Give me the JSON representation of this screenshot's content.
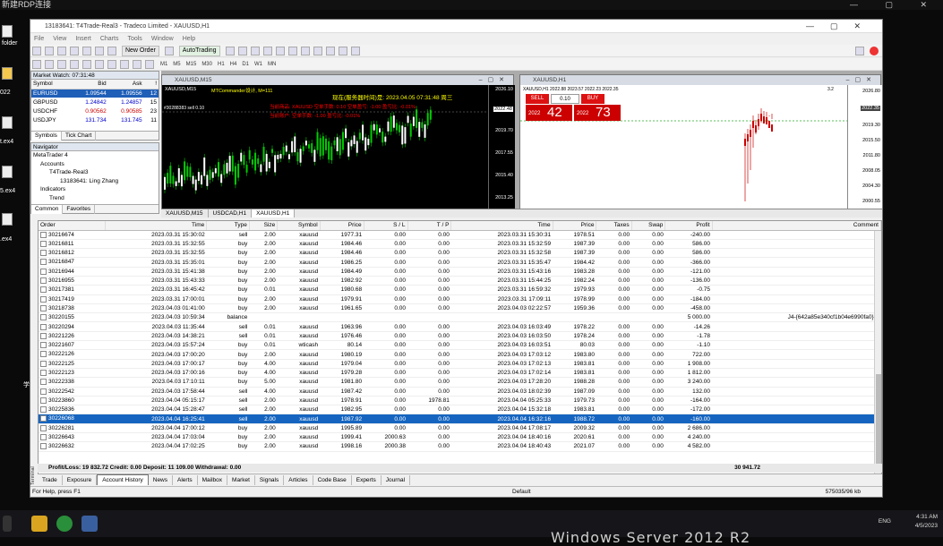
{
  "rdp": {
    "title": "新建RDP连接",
    "controls": "— ▢ ✕"
  },
  "desktop": {
    "folder_label": "folder",
    "item2": "022",
    "item3": "t.ex4",
    "item4": "5.ex4",
    "item5": ".ex4",
    "item6": "学"
  },
  "window": {
    "title": "13183641: T4Trade-Real3 - Tradeco Limited - XAUUSD,H1",
    "menu": [
      "File",
      "View",
      "Insert",
      "Charts",
      "Tools",
      "Window",
      "Help"
    ],
    "toolbar": {
      "new_order": "New Order",
      "autotrading": "AutoTrading"
    },
    "timeframes": [
      "M1",
      "M5",
      "M15",
      "M30",
      "H1",
      "H4",
      "D1",
      "W1",
      "MN"
    ]
  },
  "market_watch": {
    "header": "Market Watch: 07:31:48",
    "columns": [
      "Symbol",
      "Bid",
      "Ask",
      "!"
    ],
    "rows": [
      {
        "symbol": "EURUSD",
        "bid": "1.09544",
        "ask": "1.09556",
        "spread": "12"
      },
      {
        "symbol": "GBPUSD",
        "bid": "1.24842",
        "ask": "1.24857",
        "spread": "15"
      },
      {
        "symbol": "USDCHF",
        "bid": "0.90562",
        "ask": "0.90585",
        "spread": "23"
      },
      {
        "symbol": "USDJPY",
        "bid": "131.734",
        "ask": "131.745",
        "spread": "11"
      }
    ],
    "tabs": [
      "Symbols",
      "Tick Chart"
    ]
  },
  "navigator": {
    "header": "Navigator",
    "items": [
      "MetaTrader 4",
      "Accounts",
      "T4Trade-Real3",
      "13183641: Ling Zhang",
      "Indicators",
      "Trend"
    ],
    "tabs": [
      "Common",
      "Favorites"
    ]
  },
  "chart1": {
    "title": "XAUUSD,M15",
    "inner_label": "XAUUSD,M15",
    "ea_label": "MTCommander设计, M=111",
    "server_time": "现在(服务器时间)是: 2023.04.05 07:31:48 周三",
    "lines": [
      "当前商品: XAUUSD 空单手数: 0.10 空单盈亏: -1.00 盈亏比: -0.01%",
      "当前账户: 空单手数: -1.00 盈亏比: -0.01%"
    ],
    "price_label": "2022.48",
    "order_label": "#30288383 sell 0.10",
    "prices": [
      "2026.10",
      "2022.48",
      "2019.70",
      "2017.55",
      "2015.40",
      "2013.25"
    ]
  },
  "chart2": {
    "title": "XAUUSD,H1",
    "inner_label": "XAUUSD,H1 2022.88 2023.57 2022.23 2022.35",
    "sell": "SELL",
    "buy": "BUY",
    "lot": "0.10",
    "sell_big": "42",
    "sell_small": "2022",
    "buy_big": "73",
    "buy_small": "2022",
    "corner": "3.2",
    "prices": [
      "2026.80",
      "2022.35",
      "2019.30",
      "2015.50",
      "2011.80",
      "2008.05",
      "2004.30",
      "2000.55"
    ]
  },
  "chart_tabs": [
    "XAUUSD,M15",
    "USDCAD,H1",
    "XAUUSD,H1"
  ],
  "history": {
    "columns": [
      "Order",
      "Time",
      "Type",
      "Size",
      "Symbol",
      "Price",
      "S / L",
      "T / P",
      "Time",
      "Price",
      "Taxes",
      "Swap",
      "Profit",
      "Comment"
    ],
    "rows": [
      [
        "30216674",
        "2023.03.31 15:30:02",
        "sell",
        "2.00",
        "xauusd",
        "1977.31",
        "0.00",
        "0.00",
        "2023.03.31 15:30:31",
        "1978.51",
        "0.00",
        "0.00",
        "-240.00",
        ""
      ],
      [
        "30216811",
        "2023.03.31 15:32:55",
        "buy",
        "2.00",
        "xauusd",
        "1984.46",
        "0.00",
        "0.00",
        "2023.03.31 15:32:59",
        "1987.39",
        "0.00",
        "0.00",
        "586.00",
        ""
      ],
      [
        "30216812",
        "2023.03.31 15:32:55",
        "buy",
        "2.00",
        "xauusd",
        "1984.46",
        "0.00",
        "0.00",
        "2023.03.31 15:32:58",
        "1987.39",
        "0.00",
        "0.00",
        "586.00",
        ""
      ],
      [
        "30216847",
        "2023.03.31 15:35:01",
        "buy",
        "2.00",
        "xauusd",
        "1986.25",
        "0.00",
        "0.00",
        "2023.03.31 15:35:47",
        "1984.42",
        "0.00",
        "0.00",
        "-366.00",
        ""
      ],
      [
        "30216944",
        "2023.03.31 15:41:38",
        "buy",
        "2.00",
        "xauusd",
        "1984.49",
        "0.00",
        "0.00",
        "2023.03.31 15:43:16",
        "1983.28",
        "0.00",
        "0.00",
        "-121.00",
        ""
      ],
      [
        "30216955",
        "2023.03.31 15:43:33",
        "buy",
        "2.00",
        "xauusd",
        "1982.92",
        "0.00",
        "0.00",
        "2023.03.31 15:44:25",
        "1982.24",
        "0.00",
        "0.00",
        "-136.00",
        ""
      ],
      [
        "30217381",
        "2023.03.31 16:45:42",
        "buy",
        "0.01",
        "xauusd",
        "1980.68",
        "0.00",
        "0.00",
        "2023.03.31 16:59:32",
        "1979.93",
        "0.00",
        "0.00",
        "-0.75",
        ""
      ],
      [
        "30217419",
        "2023.03.31 17:00:01",
        "buy",
        "2.00",
        "xauusd",
        "1979.91",
        "0.00",
        "0.00",
        "2023.03.31 17:09:11",
        "1978.99",
        "0.00",
        "0.00",
        "-184.00",
        ""
      ],
      [
        "30218738",
        "2023.04.03 01:41:00",
        "buy",
        "2.00",
        "xauusd",
        "1961.65",
        "0.00",
        "0.00",
        "2023.04.03 02:22:57",
        "1959.36",
        "0.00",
        "0.00",
        "-458.00",
        ""
      ],
      [
        "30220155",
        "2023.04.03 10:59:34",
        "balance",
        "",
        "",
        "",
        "",
        "",
        "",
        "",
        "",
        "",
        "5 000.00",
        "J4-{642a85e340cf1b04e6990fa0}-6"
      ],
      [
        "30220294",
        "2023.04.03 11:35:44",
        "sell",
        "0.01",
        "xauusd",
        "1963.96",
        "0.00",
        "0.00",
        "2023.04.03 16:03:49",
        "1978.22",
        "0.00",
        "0.00",
        "-14.26",
        ""
      ],
      [
        "30221226",
        "2023.04.03 14:38:21",
        "sell",
        "0.01",
        "xauusd",
        "1976.46",
        "0.00",
        "0.00",
        "2023.04.03 16:03:50",
        "1978.24",
        "0.00",
        "0.00",
        "-1.78",
        ""
      ],
      [
        "30221607",
        "2023.04.03 15:57:24",
        "buy",
        "0.01",
        "wticash",
        "80.14",
        "0.00",
        "0.00",
        "2023.04.03 16:03:51",
        "80.03",
        "0.00",
        "0.00",
        "-1.10",
        ""
      ],
      [
        "30222126",
        "2023.04.03 17:00:20",
        "buy",
        "2.00",
        "xauusd",
        "1980.19",
        "0.00",
        "0.00",
        "2023.04.03 17:03:12",
        "1983.80",
        "0.00",
        "0.00",
        "722.00",
        ""
      ],
      [
        "30222125",
        "2023.04.03 17:00:17",
        "buy",
        "4.00",
        "xauusd",
        "1979.04",
        "0.00",
        "0.00",
        "2023.04.03 17:02:13",
        "1983.81",
        "0.00",
        "0.00",
        "1 908.00",
        ""
      ],
      [
        "30222123",
        "2023.04.03 17:00:16",
        "buy",
        "4.00",
        "xauusd",
        "1979.28",
        "0.00",
        "0.00",
        "2023.04.03 17:02:14",
        "1983.81",
        "0.00",
        "0.00",
        "1 812.00",
        ""
      ],
      [
        "30222338",
        "2023.04.03 17:10:11",
        "buy",
        "5.00",
        "xauusd",
        "1981.80",
        "0.00",
        "0.00",
        "2023.04.03 17:28:20",
        "1988.28",
        "0.00",
        "0.00",
        "3 240.00",
        ""
      ],
      [
        "30222542",
        "2023.04.03 17:58:44",
        "sell",
        "4.00",
        "xauusd",
        "1987.42",
        "0.00",
        "0.00",
        "2023.04.03 18:02:39",
        "1987.09",
        "0.00",
        "0.00",
        "132.00",
        ""
      ],
      [
        "30223860",
        "2023.04.04 05:15:17",
        "sell",
        "2.00",
        "xauusd",
        "1978.91",
        "0.00",
        "1978.81",
        "2023.04.04 05:25:33",
        "1979.73",
        "0.00",
        "0.00",
        "-164.00",
        ""
      ],
      [
        "30225836",
        "2023.04.04 15:28:47",
        "sell",
        "2.00",
        "xauusd",
        "1982.95",
        "0.00",
        "0.00",
        "2023.04.04 15:32:18",
        "1983.81",
        "0.00",
        "0.00",
        "-172.00",
        ""
      ],
      [
        "30226068",
        "2023.04.04 16:25:41",
        "sell",
        "2.00",
        "xauusd",
        "1987.92",
        "0.00",
        "0.00",
        "2023.04.04 16:32:16",
        "1988.72",
        "0.00",
        "0.00",
        "-160.00",
        ""
      ],
      [
        "30226281",
        "2023.04.04 17:00:12",
        "buy",
        "2.00",
        "xauusd",
        "1995.89",
        "0.00",
        "0.00",
        "2023.04.04 17:08:17",
        "2009.32",
        "0.00",
        "0.00",
        "2 686.00",
        ""
      ],
      [
        "30226643",
        "2023.04.04 17:03:04",
        "buy",
        "2.00",
        "xauusd",
        "1999.41",
        "2000.63",
        "0.00",
        "2023.04.04 18:40:16",
        "2020.61",
        "0.00",
        "0.00",
        "4 240.00",
        ""
      ],
      [
        "30226632",
        "2023.04.04 17:02:25",
        "buy",
        "2.00",
        "xauusd",
        "1998.16",
        "2000.38",
        "0.00",
        "2023.04.04 18:40:43",
        "2021.07",
        "0.00",
        "0.00",
        "4 582.00",
        ""
      ]
    ],
    "selected_index": 20,
    "totals_label": "Profit/Loss: 19 832.72  Credit: 0.00  Deposit: 11 109.00  Withdrawal: 0.00",
    "totals_value": "30 941.72"
  },
  "terminal_tabs": [
    "Trade",
    "Exposure",
    "Account History",
    "News",
    "Alerts",
    "Mailbox",
    "Market",
    "Signals",
    "Articles",
    "Code Base",
    "Experts",
    "Journal"
  ],
  "terminal_label": "Terminal",
  "status": {
    "help": "For Help, press F1",
    "profile": "Default",
    "traffic": "575035/96 kb"
  },
  "tray": {
    "time": "4:31 AM",
    "date": "4/5/2023",
    "lang": "ENG"
  },
  "watermark": "Windows Server 2012 R2"
}
